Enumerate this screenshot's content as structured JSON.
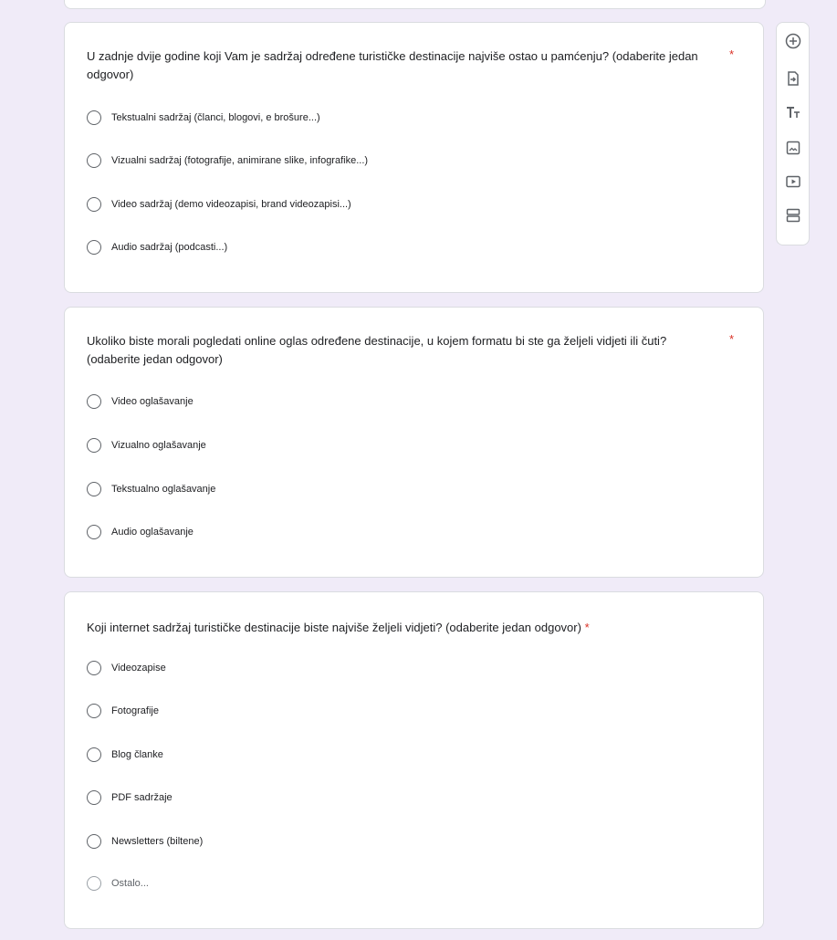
{
  "questions": [
    {
      "title": "U zadnje dvije godine koji Vam je sadržaj određene turističke destinacije najviše ostao u pamćenju? (odaberite jedan odgovor)",
      "required_mark": "*",
      "options": [
        "Tekstualni sadržaj (članci, blogovi, e brošure...)",
        "Vizualni sadržaj (fotografije, animirane slike, infografike...)",
        "Video sadržaj (demo videozapisi, brand videozapisi...)",
        "Audio sadržaj (podcasti...)"
      ]
    },
    {
      "title": "Ukoliko biste morali pogledati online oglas određene destinacije, u kojem formatu bi ste ga željeli vidjeti ili čuti? (odaberite jedan odgovor)",
      "required_mark": "*",
      "options": [
        "Video oglašavanje",
        "Vizualno oglašavanje",
        "Tekstualno oglašavanje",
        "Audio oglašavanje"
      ]
    },
    {
      "title": "Koji internet sadržaj turističke destinacije biste najviše željeli vidjeti? (odaberite jedan odgovor)",
      "required_mark": "*",
      "options": [
        "Videozapise",
        "Fotografije",
        "Blog članke",
        "PDF sadržaje",
        "Newsletters (biltene)",
        "Ostalo..."
      ]
    }
  ],
  "toolbar": {
    "icons": [
      "add-question-icon",
      "import-questions-icon",
      "add-title-icon",
      "add-image-icon",
      "add-video-icon",
      "add-section-icon"
    ]
  },
  "colors": {
    "background": "#f0ebf8",
    "required": "#d93025",
    "icon": "#5f6368"
  }
}
